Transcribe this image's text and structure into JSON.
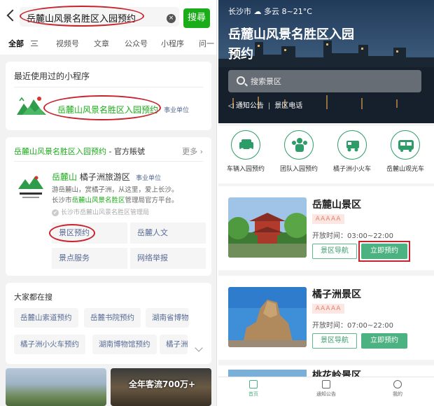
{
  "left": {
    "search": {
      "query": "岳麓山风景名胜区入园预约",
      "clear": "×",
      "button": "搜尋"
    },
    "tabs": [
      "全部",
      "视频号",
      "文章",
      "公众号",
      "小程序",
      "问一"
    ],
    "recent": {
      "title": "最近使用过的小程序",
      "name": "岳麓山风景名胜区入园预约",
      "badge": "事业单位"
    },
    "official": {
      "title_green": "岳麓山风景名胜区入园预约",
      "title_plain": " - 官方賬號",
      "more": "更多",
      "name_green": "岳麓山",
      "name_plain": " 橘子洲旅游区",
      "badge": "事业单位",
      "desc_1": "游岳麓山，赏橘子洲，从这里，爱上长沙。",
      "desc_2": "长沙市",
      "desc_3": "岳麓山风景名胜区",
      "desc_4": "管理局官方平台。",
      "org": "长沙市岳麓山风景名胜区管理局",
      "menu": [
        "景区预约",
        "岳麓人文",
        "景点服务",
        "网络举报"
      ]
    },
    "hot": {
      "title": "大家都在搜",
      "chips": [
        "岳麓山索道预约",
        "岳麓书院预约",
        "湖南省博物",
        "橘子洲小火车预约",
        "湖南博物馆预约",
        "橘子洲"
      ]
    },
    "banner_caption": "全年客流700万+"
  },
  "right": {
    "weather": {
      "city": "长沙市",
      "text": "多云 8~21°C"
    },
    "title": "岳麓山风景名胜区入园预约",
    "search_placeholder": "搜索景区",
    "links": [
      "通知公告",
      "景区电话"
    ],
    "services": [
      "车辆入园预约",
      "团队入园预约",
      "橘子洲小火车",
      "岳麓山观光车"
    ],
    "spots": [
      {
        "name": "岳麓山景区",
        "rating": "AAAAA",
        "hours": "开放时间：03:00~22:00",
        "nav": "景区导航",
        "book": "立即预约"
      },
      {
        "name": "橘子洲景区",
        "rating": "AAAAA",
        "hours": "开放时间：07:00~22:00",
        "nav": "景区导航",
        "book": "立即预约"
      },
      {
        "name": "桃花岭景区"
      }
    ],
    "tabbar": [
      "首页",
      "通知公告",
      "我的"
    ]
  },
  "colors": {
    "wechat_green": "#1aad19",
    "link_blue": "#576b95",
    "app_green": "#4db282",
    "highlight_red": "#c8232c"
  }
}
